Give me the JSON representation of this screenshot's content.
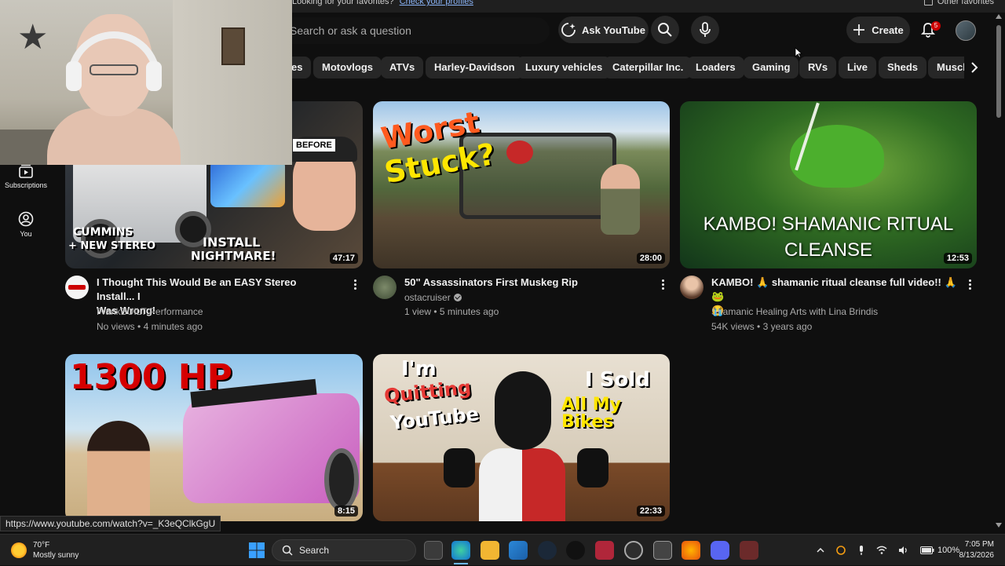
{
  "bookmarks": {
    "promo_text": "Looking for your favorites?",
    "promo_link": "Check your profiles",
    "other_favorites": "Other favorites"
  },
  "header": {
    "search_placeholder": "Search or ask a question",
    "ask_label": "Ask YouTube",
    "create_label": "Create",
    "notifications_count": "5"
  },
  "chips": [
    "es",
    "Motovlogs",
    "ATVs",
    "Harley-Davidson",
    "Luxury vehicles",
    "Caterpillar Inc.",
    "Loaders",
    "Gaming",
    "RVs",
    "Live",
    "Sheds",
    "Muscle"
  ],
  "sidebar": {
    "items": [
      {
        "label": "Subscriptions",
        "icon": "subscriptions-icon"
      },
      {
        "label": "You",
        "icon": "you-icon"
      }
    ]
  },
  "videos": [
    {
      "title": "I Thought This Would Be an EASY Stereo Install... I Was Wrong!",
      "title_line1": "I Thought This Would Be an EASY Stereo Install... I",
      "title_line2": "Was Wrong!",
      "channel": "FrankBUILT Performance",
      "views": "No views",
      "age": "4 minutes ago",
      "duration": "47:17",
      "thumb_text": [
        "BEFORE",
        "CUMMINS",
        "+ NEW STEREO",
        "INSTALL",
        "NIGHTMARE!"
      ]
    },
    {
      "title": "50\" Assassinators First Muskeg Rip",
      "channel": "ostacruiser",
      "verified": true,
      "views": "1 view",
      "age": "5 minutes ago",
      "duration": "28:00",
      "thumb_text": [
        "Worst",
        "Stuck?"
      ]
    },
    {
      "title_line1": "KAMBO! 🙏 shamanic ritual cleanse full video!! 🙏 🐸",
      "title_line2": "😭",
      "channel": "Shamanic Healing Arts with Lina Brindis",
      "views": "54K views",
      "age": "3 years ago",
      "duration": "12:53",
      "thumb_text": [
        "KAMBO! SHAMANIC RITUAL",
        "CLEANSE"
      ]
    },
    {
      "duration": "8:15",
      "thumb_text": [
        "1300 HP"
      ]
    },
    {
      "duration": "22:33",
      "thumb_text": [
        "I'm",
        "Quitting",
        "YouTube",
        "I Sold",
        "All My Bikes"
      ]
    }
  ],
  "status_url": "https://www.youtube.com/watch?v=_K3eQClkGgU",
  "taskbar": {
    "temperature": "70°F",
    "weather": "Mostly sunny",
    "search_label": "Search",
    "battery": "100%",
    "time": "7:05 PM",
    "date": "8/13/2026"
  },
  "colors": {
    "background": "#0f0f0f",
    "chip": "#272727",
    "notification": "#cc0000"
  }
}
